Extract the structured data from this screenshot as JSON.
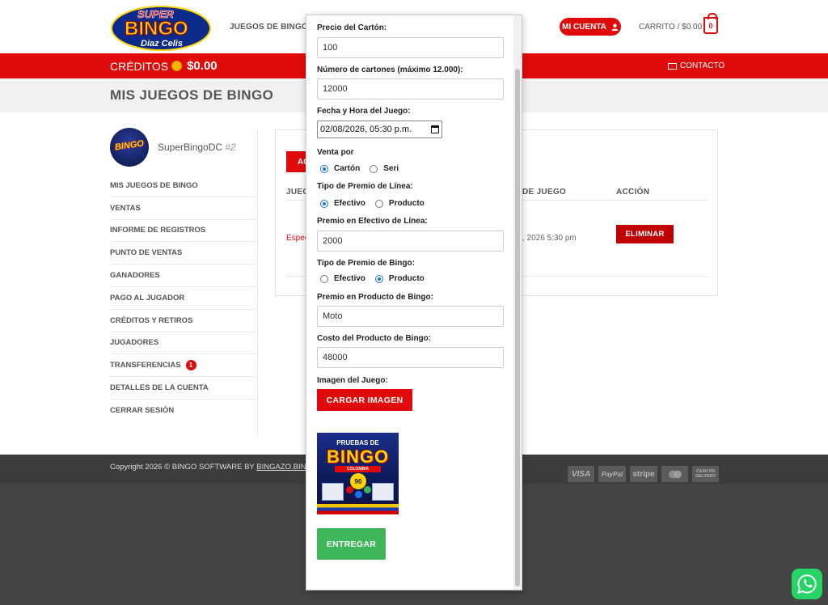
{
  "header": {
    "logo_text": "SUPER BINGO Diaz Celis",
    "nav_bingo": "JUEGOS DE BINGO",
    "account_label": "MI CUENTA",
    "cart_label": "CARRITO / $0.00",
    "cart_count": "0"
  },
  "redbar": {
    "credits_label": "CRÉDITOS",
    "credits_value": "$0.00",
    "contact_label": "CONTACTO"
  },
  "page": {
    "title": "MIS JUEGOS DE BINGO"
  },
  "profile": {
    "username": "SuperBingoDC",
    "user_id": "#2",
    "avatar_text": "BINGO"
  },
  "sidebar": {
    "items": [
      {
        "label": "MIS JUEGOS DE BINGO"
      },
      {
        "label": "VENTAS"
      },
      {
        "label": "INFORME DE REGISTROS"
      },
      {
        "label": "PUNTO DE VENTAS"
      },
      {
        "label": "GANADORES"
      },
      {
        "label": "PAGO AL JUGADOR"
      },
      {
        "label": "CRÉDITOS Y RETIROS"
      },
      {
        "label": "JUGADORES"
      },
      {
        "label": "TRANSFERENCIAS",
        "badge": "1"
      },
      {
        "label": "DETALLES DE LA CUENTA"
      },
      {
        "label": "CERRAR SESIÓN"
      }
    ]
  },
  "main": {
    "add_button_partial": "AG",
    "columns": [
      "JUEG",
      "DE JUEGO",
      "ACCIÓN"
    ],
    "rows": [
      {
        "game_partial": "Espec",
        "date_partial": ", 2026 5:30 pm",
        "action": "ELIMINAR"
      }
    ]
  },
  "modal": {
    "price_label": "Precio del Cartón:",
    "price_value": "100",
    "count_label": "Número de cartones (máximo 12.000):",
    "count_value": "12000",
    "datetime_label": "Fecha y Hora del Juego:",
    "datetime_value": "02/08/2026, 05:30 p.m.",
    "sale_label": "Venta por",
    "sale_options": [
      "Cartón",
      "Seri"
    ],
    "sale_selected": "Cartón",
    "line_prize_type_label": "Tipo de Premio de Línea:",
    "line_prize_options": [
      "Efectivo",
      "Producto"
    ],
    "line_prize_selected": "Efectivo",
    "line_cash_label": "Premio en Efectivo de Línea:",
    "line_cash_value": "2000",
    "bingo_prize_type_label": "Tipo de Premio de Bingo:",
    "bingo_prize_options": [
      "Efectivo",
      "Producto"
    ],
    "bingo_prize_selected": "Producto",
    "bingo_product_label": "Premio en Producto de Bingo:",
    "bingo_product_value": "Moto",
    "bingo_cost_label": "Costo del Producto de Bingo:",
    "bingo_cost_value": "48000",
    "image_label": "Imagen del Juego:",
    "upload_button": "CARGAR IMAGEN",
    "game_image": {
      "top_text": "PRUEBAS DE",
      "main_text": "BINGO",
      "sub_text": "COLOMBIA",
      "number": "90"
    },
    "submit_button": "ENTREGAR"
  },
  "footer": {
    "copyright_prefix": "Copyright 2026 © BINGO SOFTWARE BY ",
    "copyright_link": "BINGAZO.BIN",
    "payment_logos": [
      "VISA",
      "PayPal",
      "stripe",
      "mastercard-icon",
      "CASH ON DELIVERY"
    ]
  },
  "colors": {
    "brand_red": "#e00a0a",
    "success_green": "#3eb75c",
    "whatsapp_green": "#25d366",
    "footer_dark": "#444444"
  }
}
